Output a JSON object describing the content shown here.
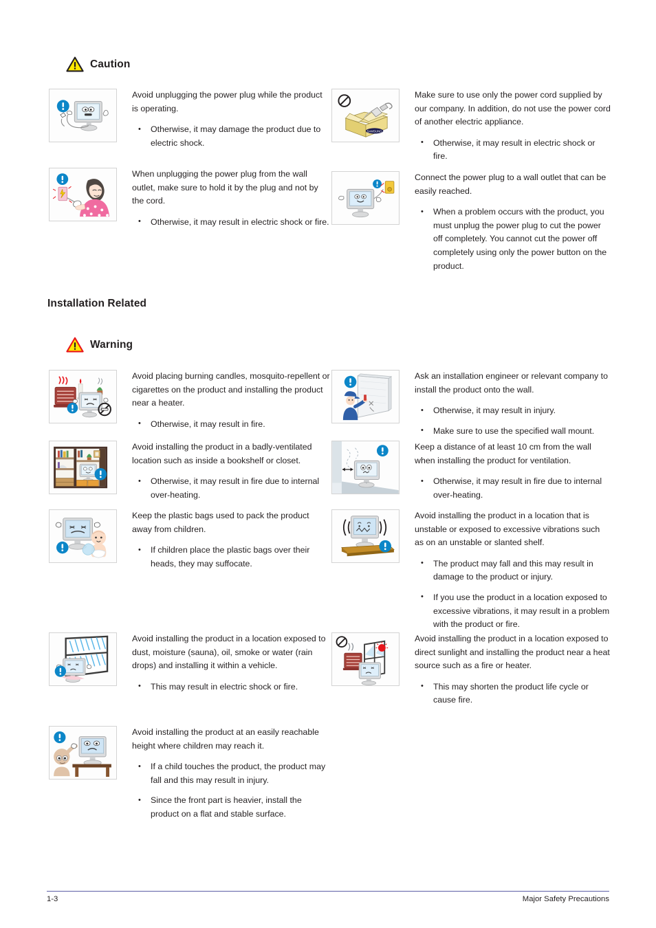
{
  "page": {
    "footer_page_number": "1-3",
    "footer_chapter": "Major Safety Precautions"
  },
  "colors": {
    "warning_triangle_border": "#e8161c",
    "caution_triangle_border": "#231f20",
    "triangle_fill": "#ffe900",
    "info_blue": "#0c86c8",
    "footer_rule": "#5b5ea6",
    "text": "#231f20",
    "thumb_border": "#d3d3d3"
  },
  "sections": [
    {
      "id": "power-caution",
      "heading": {
        "label": "Caution",
        "icon": "caution-triangle-icon"
      },
      "items": [
        {
          "id": "avoid-unplugging-while-operating",
          "column": "left",
          "image": "monitor-unplug-warning-illustration",
          "lead": "Avoid unplugging the power plug while the product is operating.",
          "bullets": [
            "Otherwise, it may damage the product due to electric shock."
          ]
        },
        {
          "id": "use-supplied-power-cord",
          "column": "right",
          "image": "prohibited-box-power-cord-illustration",
          "lead": "Make sure to use only the power cord supplied by our company. In addition, do not use the power cord of another electric appliance.",
          "bullets": [
            "Otherwise, it may result in electric shock or fire."
          ]
        },
        {
          "id": "hold-plug-not-cord",
          "column": "left",
          "image": "woman-pulling-plug-illustration",
          "lead": "When unplugging the power plug from the wall outlet, make sure to hold it by the plug and not by the cord.",
          "bullets": [
            "Otherwise, it may result in electric shock or fire."
          ]
        },
        {
          "id": "wall-outlet-easily-reached",
          "column": "right",
          "image": "monitor-wall-outlet-illustration",
          "lead": "Connect the power plug to a wall outlet that can be easily reached.",
          "bullets": [
            "When a problem occurs with the product, you must unplug the power plug to cut the power off completely. You cannot cut the power off completely using only the power button on the product."
          ]
        }
      ]
    },
    {
      "id": "installation-related",
      "title": "Installation Related",
      "heading": {
        "label": "Warning",
        "icon": "warning-triangle-icon"
      },
      "items": [
        {
          "id": "avoid-burning-candles",
          "column": "left",
          "image": "heater-candle-cigarette-illustration",
          "lead": "Avoid placing burning candles,  mosquito-repellent or cigarettes on the product and installing the product near a heater.",
          "bullets": [
            "Otherwise, it may result in fire."
          ]
        },
        {
          "id": "ask-installation-engineer",
          "column": "right",
          "image": "installer-wall-mount-illustration",
          "lead": "Ask an installation engineer or relevant company to install the product onto the wall.",
          "bullets": [
            "Otherwise, it may result in injury.",
            "Make sure to use the specified wall mount."
          ]
        },
        {
          "id": "avoid-badly-ventilated-location",
          "column": "left",
          "image": "bookshelf-monitor-illustration",
          "lead": "Avoid installing the product in a badly-ventilated location such as inside a bookshelf or closet.",
          "bullets": [
            "Otherwise, it may result in fire due to internal over-heating."
          ]
        },
        {
          "id": "keep-distance-from-wall",
          "column": "right",
          "image": "monitor-wall-distance-illustration",
          "lead": "Keep a distance of at least 10 cm from the wall when installing the product for ventilation.",
          "bullets": [
            "Otherwise, it may result in fire due to internal over-heating."
          ]
        },
        {
          "id": "keep-plastic-bags-away",
          "column": "left",
          "image": "baby-plastic-bag-illustration",
          "lead": "Keep the plastic bags used to pack the product away from children.",
          "bullets": [
            " If children place the plastic bags over their heads, they may suffocate."
          ]
        },
        {
          "id": "avoid-unstable-location",
          "column": "right",
          "image": "monitor-vibration-shelf-illustration",
          "lead": "Avoid installing the product in a location that is unstable or exposed to excessive vibrations such as on an unstable or slanted shelf.",
          "bullets": [
            "The product may fall and this may result in damage to the product or injury.",
            "If you use the product in a location exposed to excessive vibrations, it may result in a problem with the product or fire."
          ]
        },
        {
          "id": "avoid-dust-moisture",
          "column": "left",
          "image": "monitor-rain-window-illustration",
          "lead": "Avoid installing the product in a location exposed to dust, moisture (sauna), oil, smoke or water (rain drops) and installing it within a vehicle.",
          "bullets": [
            "This may result in electric shock or fire."
          ]
        },
        {
          "id": "avoid-direct-sunlight",
          "column": "right",
          "image": "sunlight-heater-monitor-illustration",
          "lead": "Avoid installing the product in a location exposed to direct sunlight and installing the product near a heat source such as a fire or heater.",
          "bullets": [
            "This may shorten the product life cycle or cause fire."
          ]
        },
        {
          "id": "avoid-reachable-height",
          "column": "left",
          "image": "child-reaching-monitor-illustration",
          "lead": "Avoid installing the product at an easily reachable height where children may reach it.",
          "bullets": [
            "If a child touches the product, the product may fall and this may result in injury.",
            "Since the front part is heavier, install the product on a flat and stable surface."
          ]
        }
      ]
    }
  ]
}
